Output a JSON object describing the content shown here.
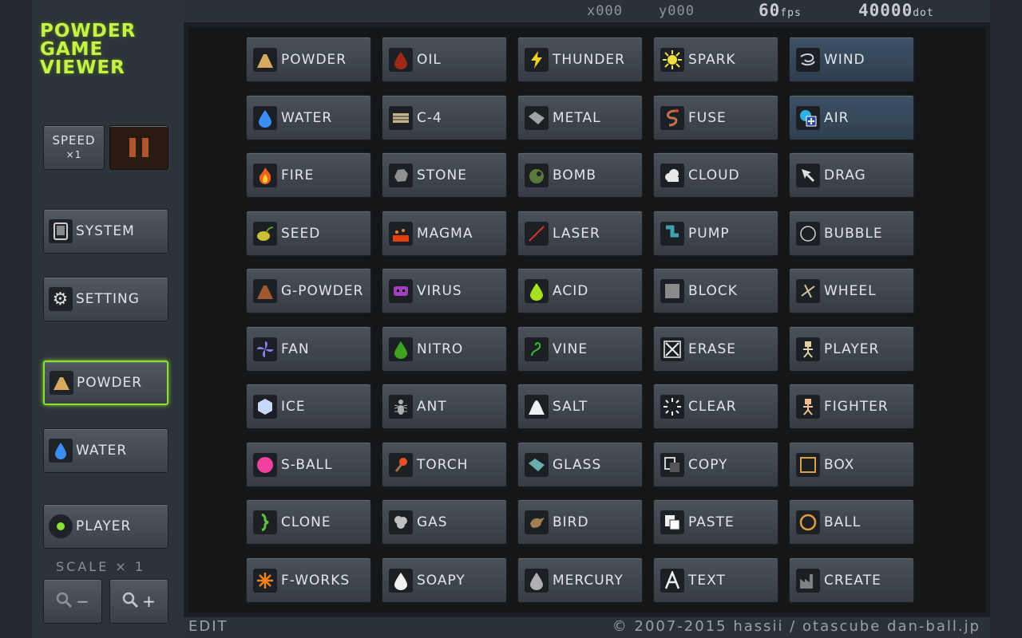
{
  "status": {
    "x": "x000",
    "y": "y000",
    "fps_value": "60",
    "fps_unit": "fps",
    "dot_value": "40000",
    "dot_unit": "dot"
  },
  "logo": {
    "line1": "Powder",
    "line2": "Game",
    "line3": "Viewer"
  },
  "sidebar": {
    "speed_label": "Speed",
    "speed_mult": "×1",
    "system_label": "System",
    "setting_label": "Setting",
    "selected_primary": "Powder",
    "selected_secondary": "Water",
    "player_label": "Player",
    "scale_label": "Scale × 1",
    "zoom_out": "−",
    "zoom_in": "+"
  },
  "elements": [
    {
      "label": "Powder",
      "icon": "powder-icon",
      "color": "#d8a860"
    },
    {
      "label": "Oil",
      "icon": "oil-drop-icon",
      "color": "#a02818"
    },
    {
      "label": "Thunder",
      "icon": "lightning-icon",
      "color": "#f0d020"
    },
    {
      "label": "Spark",
      "icon": "spark-icon",
      "color": "#f0e040"
    },
    {
      "label": "Wind",
      "icon": "wind-icon",
      "color": "#c8d0d8"
    },
    {
      "label": "Water",
      "icon": "water-drop-icon",
      "color": "#3a8ef0"
    },
    {
      "label": "C-4",
      "icon": "c4-icon",
      "color": "#c8b088"
    },
    {
      "label": "Metal",
      "icon": "metal-icon",
      "color": "#a0a4a8"
    },
    {
      "label": "Fuse",
      "icon": "fuse-icon",
      "color": "#c07050"
    },
    {
      "label": "Air",
      "icon": "air-icon",
      "color": "#30b0e0"
    },
    {
      "label": "Fire",
      "icon": "fire-icon",
      "color": "#f06020"
    },
    {
      "label": "Stone",
      "icon": "stone-icon",
      "color": "#909090"
    },
    {
      "label": "Bomb",
      "icon": "bomb-icon",
      "color": "#5a7a3a"
    },
    {
      "label": "Cloud",
      "icon": "cloud-icon",
      "color": "#e8e8e8"
    },
    {
      "label": "Drag",
      "icon": "drag-arrow-icon",
      "color": "#e0e0e0"
    },
    {
      "label": "Seed",
      "icon": "seed-icon",
      "color": "#c8c030"
    },
    {
      "label": "Magma",
      "icon": "magma-icon",
      "color": "#e04010"
    },
    {
      "label": "Laser",
      "icon": "laser-icon",
      "color": "#d03030"
    },
    {
      "label": "Pump",
      "icon": "pump-icon",
      "color": "#40a0b0"
    },
    {
      "label": "Bubble",
      "icon": "bubble-icon",
      "color": "#d0d0d0"
    },
    {
      "label": "G-Powder",
      "icon": "gunpowder-icon",
      "color": "#a05a30"
    },
    {
      "label": "Virus",
      "icon": "virus-icon",
      "color": "#a040c0"
    },
    {
      "label": "Acid",
      "icon": "acid-drop-icon",
      "color": "#a8e020"
    },
    {
      "label": "Block",
      "icon": "block-icon",
      "color": "#8a8a8a"
    },
    {
      "label": "Wheel",
      "icon": "wheel-icon",
      "color": "#d0c0a0"
    },
    {
      "label": "Fan",
      "icon": "fan-icon",
      "color": "#8080f0"
    },
    {
      "label": "Nitro",
      "icon": "nitro-drop-icon",
      "color": "#40a020"
    },
    {
      "label": "Vine",
      "icon": "vine-icon",
      "color": "#30c030"
    },
    {
      "label": "Erase",
      "icon": "erase-icon",
      "color": "#f0f0f0"
    },
    {
      "label": "Player",
      "icon": "player-icon",
      "color": "#e0d0a0"
    },
    {
      "label": "Ice",
      "icon": "ice-icon",
      "color": "#c8d8f8"
    },
    {
      "label": "Ant",
      "icon": "ant-icon",
      "color": "#b0b0b0"
    },
    {
      "label": "Salt",
      "icon": "salt-icon",
      "color": "#f0f0f0"
    },
    {
      "label": "Clear",
      "icon": "clear-icon",
      "color": "#f0f0f0"
    },
    {
      "label": "Fighter",
      "icon": "fighter-icon",
      "color": "#f0c090"
    },
    {
      "label": "S-Ball",
      "icon": "superball-icon",
      "color": "#f040a0"
    },
    {
      "label": "Torch",
      "icon": "torch-icon",
      "color": "#f05020"
    },
    {
      "label": "Glass",
      "icon": "glass-icon",
      "color": "#80d0d0"
    },
    {
      "label": "Copy",
      "icon": "copy-icon",
      "color": "#d0d0d0"
    },
    {
      "label": "Box",
      "icon": "box-icon",
      "color": "#e0a040"
    },
    {
      "label": "Clone",
      "icon": "clone-icon",
      "color": "#60c040"
    },
    {
      "label": "Gas",
      "icon": "gas-icon",
      "color": "#c0c0c0"
    },
    {
      "label": "Bird",
      "icon": "bird-icon",
      "color": "#a08050"
    },
    {
      "label": "Paste",
      "icon": "paste-icon",
      "color": "#e0e0e0"
    },
    {
      "label": "Ball",
      "icon": "ball-icon",
      "color": "#e0a040"
    },
    {
      "label": "F-Works",
      "icon": "fireworks-icon",
      "color": "#f08020"
    },
    {
      "label": "Soapy",
      "icon": "soapy-drop-icon",
      "color": "#f0f0f0"
    },
    {
      "label": "Mercury",
      "icon": "mercury-drop-icon",
      "color": "#b0b0b0"
    },
    {
      "label": "Text",
      "icon": "text-icon",
      "color": "#f0f0f0"
    },
    {
      "label": "Create",
      "icon": "create-icon",
      "color": "#808080"
    }
  ],
  "footer": {
    "edit_label": "Edit",
    "copyright": "© 2007-2015 hassii / otascube  dan-ball.jp"
  }
}
